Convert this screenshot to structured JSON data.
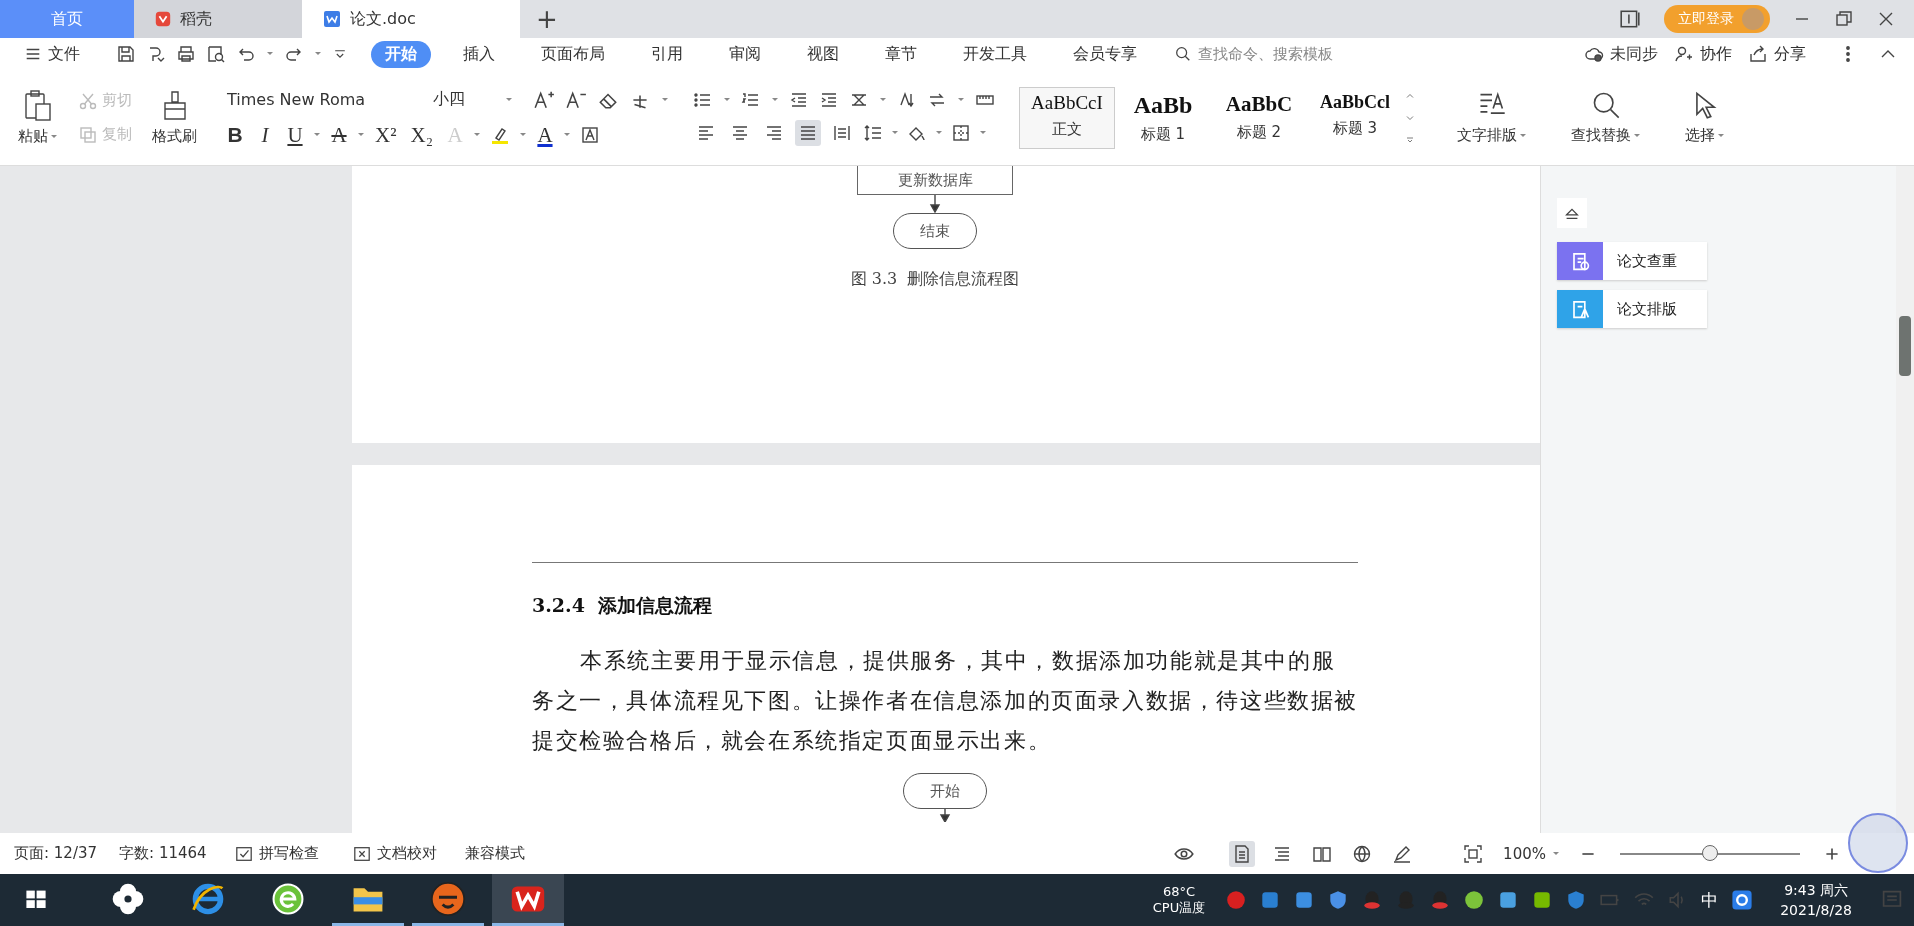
{
  "tabs": [
    {
      "label": "首页",
      "kind": "home",
      "selected": false
    },
    {
      "label": "稻壳",
      "kind": "app",
      "selected": false
    },
    {
      "label": "论文.doc",
      "kind": "doc",
      "selected": true
    }
  ],
  "new_tab": "+",
  "login_button": "立即登录",
  "file_menu": "文件",
  "menu_tabs": [
    {
      "label": "开始",
      "selected": true
    },
    {
      "label": "插入",
      "selected": false
    },
    {
      "label": "页面布局",
      "selected": false
    },
    {
      "label": "引用",
      "selected": false
    },
    {
      "label": "审阅",
      "selected": false
    },
    {
      "label": "视图",
      "selected": false
    },
    {
      "label": "章节",
      "selected": false
    },
    {
      "label": "开发工具",
      "selected": false
    },
    {
      "label": "会员专享",
      "selected": false
    }
  ],
  "search": {
    "placeholder": "查找命令、搜索模板"
  },
  "menu_actions": [
    {
      "label": "未同步",
      "kind": "sync"
    },
    {
      "label": "协作",
      "kind": "collab"
    },
    {
      "label": "分享",
      "kind": "share"
    }
  ],
  "ribbon": {
    "paste": "粘贴",
    "edit_buttons": [
      {
        "label": "剪切",
        "kind": "cut",
        "disabled": true
      },
      {
        "label": "复制",
        "kind": "copy",
        "disabled": true
      }
    ],
    "format_painter": "格式刷",
    "font_name": "Times New Roma",
    "font_size": "小四",
    "format_buttons": [
      {
        "label": "B",
        "kind": "bold"
      },
      {
        "label": "I",
        "kind": "italic"
      },
      {
        "label": "U",
        "kind": "underline"
      },
      {
        "label": "A",
        "kind": "strike"
      },
      {
        "label": "X²",
        "kind": "sup"
      },
      {
        "label": "X₂",
        "kind": "sub"
      },
      {
        "label": "A",
        "kind": "effect"
      },
      {
        "label": "A",
        "kind": "color"
      }
    ],
    "alignments": [
      {
        "kind": "left",
        "selected": false
      },
      {
        "kind": "center",
        "selected": false
      },
      {
        "kind": "right",
        "selected": false
      },
      {
        "kind": "justify",
        "selected": true
      },
      {
        "kind": "distribute",
        "selected": false
      }
    ],
    "styles": [
      {
        "preview": "AaBbCcI",
        "label": "正文",
        "kind": "body",
        "selected": true
      },
      {
        "preview": "AaBb",
        "label": "标题 1",
        "kind": "h1",
        "selected": false
      },
      {
        "preview": "AaBbC",
        "label": "标题 2",
        "kind": "h2",
        "selected": false
      },
      {
        "preview": "AaBbCcl",
        "label": "标题 3",
        "kind": "h3",
        "selected": false
      }
    ],
    "big_tools": [
      {
        "label": "文字排版",
        "kind": "layout"
      },
      {
        "label": "查找替换",
        "kind": "find"
      },
      {
        "label": "选择",
        "kind": "select"
      }
    ]
  },
  "document": {
    "flow_box": "更新数据库",
    "end_node": "结束",
    "caption": "图 3.3  删除信息流程图",
    "heading": "3.2.4  添加信息流程",
    "paragraph": "本系统主要用于显示信息，提供服务，其中，数据添加功能就是其中的服务之一，具体流程见下图。让操作者在信息添加的页面录入数据，待这些数据被提交检验合格后，就会在系统指定页面显示出来。",
    "start_node": "开始"
  },
  "side_panel": {
    "items": [
      {
        "label": "论文查重",
        "color": "#7b72f0"
      },
      {
        "label": "论文排版",
        "color": "#2fa3e8"
      }
    ]
  },
  "status_bar": {
    "page": "页面: 12/37",
    "words": "字数: 11464",
    "tools": [
      {
        "label": "拼写检查",
        "kind": "spell"
      },
      {
        "label": "文档校对",
        "kind": "proof"
      }
    ],
    "mode": "兼容模式",
    "views": [
      {
        "kind": "page",
        "selected": true
      },
      {
        "kind": "outline",
        "selected": false
      },
      {
        "kind": "read",
        "selected": false
      },
      {
        "kind": "web",
        "selected": false
      },
      {
        "kind": "write",
        "selected": false
      }
    ],
    "zoom": "100%",
    "zoom_slider": {
      "level": 0.5
    }
  },
  "taskbar": {
    "apps": [
      {
        "kind": "fan",
        "running": false,
        "selected": false
      },
      {
        "kind": "ie",
        "running": false,
        "selected": false
      },
      {
        "kind": "green",
        "running": false,
        "selected": false
      },
      {
        "kind": "folder",
        "running": true,
        "selected": false
      },
      {
        "kind": "orange",
        "running": true,
        "selected": false
      },
      {
        "kind": "wps",
        "running": true,
        "selected": true
      }
    ],
    "cpu_temp": "68°C",
    "cpu_label": "CPU温度",
    "ime": "中",
    "time": "9:43 周六",
    "date": "2021/8/28"
  }
}
